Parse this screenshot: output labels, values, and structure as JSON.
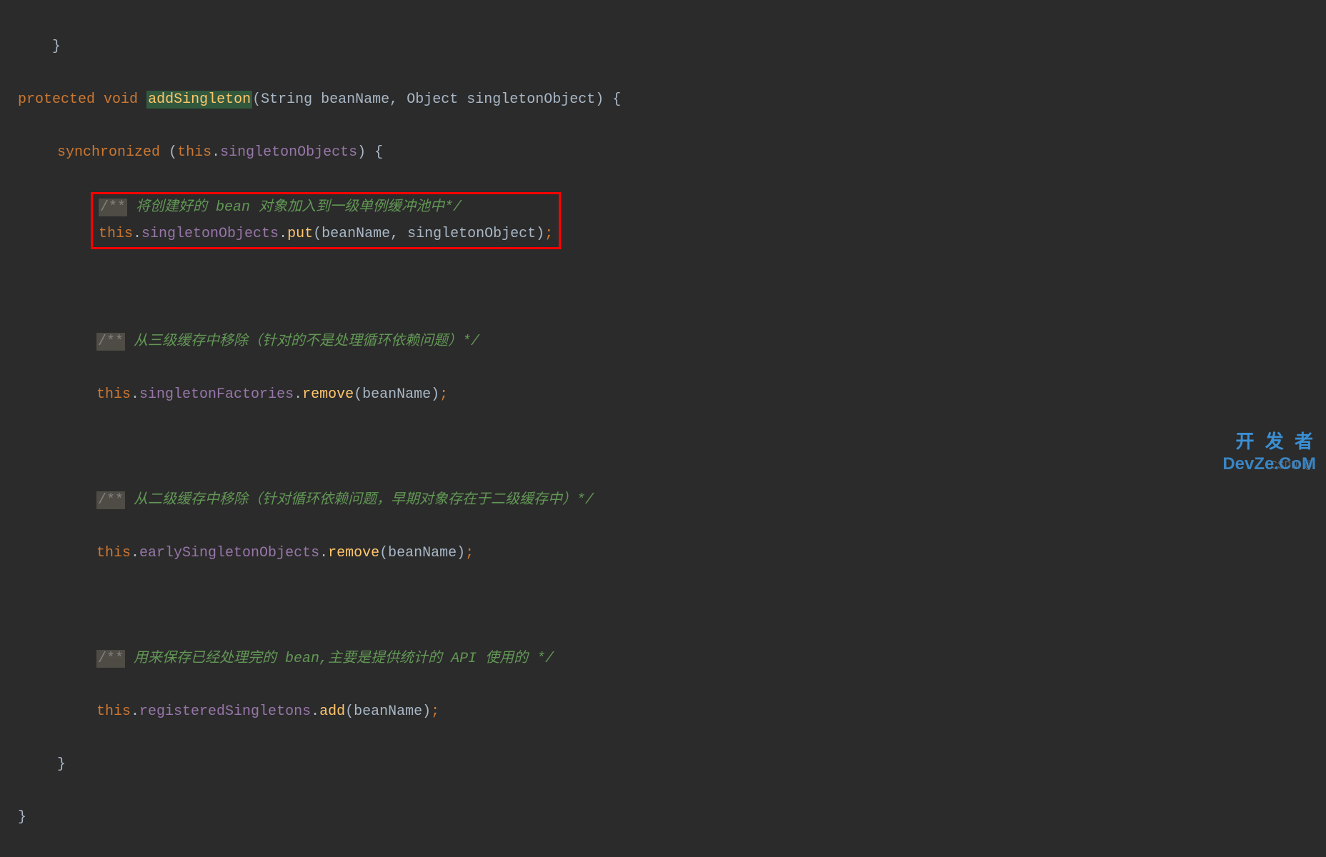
{
  "code": {
    "line0_close": "}",
    "modifier": "protected",
    "returnType": "void",
    "methodName": "addSingleton",
    "param1Type": "String",
    "param1Name": "beanName",
    "param2Type": "Object",
    "param2Name": "singletonObject",
    "sync_kw": "synchronized",
    "this_kw": "this",
    "field_singletonObjects": "singletonObjects",
    "comment_marker": "/**",
    "comment1_pre": " 将创建好的 ",
    "comment1_em": "bean",
    "comment1_post": " 对象加入到一级单例缓冲池中*/",
    "method_put": "put",
    "arg_beanName": "beanName",
    "arg_singletonObject": "singletonObject",
    "comment2": " 从三级缓存中移除（针对的不是处理循环依赖问题）*/",
    "field_singletonFactories": "singletonFactories",
    "method_remove": "remove",
    "comment3": " 从二级缓存中移除（针对循环依赖问题，早期对象存在于二级缓存中）*/",
    "field_earlySingletonObjects": "earlySingletonObjects",
    "comment4_pre": " 用来保存已经处理完的 ",
    "comment4_em1": "bean",
    "comment4_mid": ",主要是提供统计的 ",
    "comment4_em2": "API",
    "comment4_post": " 使用的 */",
    "field_registeredSingletons": "registeredSingletons",
    "method_add": "add",
    "brace_open": "{",
    "brace_close": "}",
    "paren_open": "(",
    "paren_close": ")",
    "comma": ", ",
    "dot": ".",
    "semi": ";"
  },
  "watermark": {
    "csdn": "CSDN @",
    "top": "开 发 者",
    "brand": "DevZe.CoM"
  }
}
